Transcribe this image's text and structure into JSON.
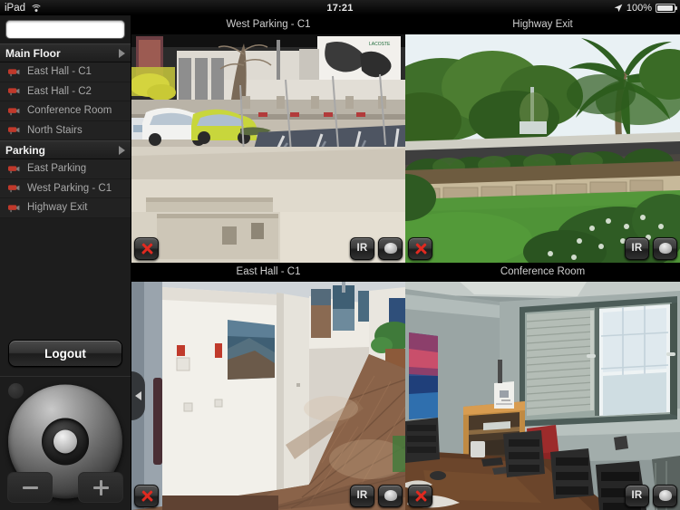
{
  "statusbar": {
    "device": "iPad",
    "wifi_icon": "wifi-icon",
    "time": "17:21",
    "location_icon": "location-arrow-icon",
    "battery_percent": "100%",
    "battery_icon": "battery-icon"
  },
  "sidebar": {
    "search": {
      "value": "",
      "placeholder": ""
    },
    "groups": [
      {
        "label": "Main Floor",
        "expanded": true,
        "cameras": [
          {
            "label": "East Hall - C1"
          },
          {
            "label": "East Hall - C2"
          },
          {
            "label": "Conference Room"
          },
          {
            "label": "North Stairs"
          }
        ]
      },
      {
        "label": "Parking",
        "expanded": true,
        "cameras": [
          {
            "label": "East Parking"
          },
          {
            "label": "West Parking - C1"
          },
          {
            "label": "Highway Exit"
          }
        ]
      }
    ],
    "logout_label": "Logout",
    "ptz": {
      "zoom_out_label": "−",
      "zoom_in_label": "+"
    }
  },
  "grid": {
    "cells": [
      {
        "title": "West Parking - C1",
        "selected": false,
        "scene": "outdoor-parking-lot",
        "controls": {
          "close_label": "close-icon",
          "ir_label": "IR",
          "record_label": "record-icon"
        }
      },
      {
        "title": "Highway Exit",
        "selected": true,
        "scene": "garden-palm-trees",
        "controls": {
          "close_label": "close-icon",
          "ir_label": "IR",
          "record_label": "record-icon"
        }
      },
      {
        "title": "East Hall - C1",
        "selected": false,
        "scene": "office-hallway",
        "controls": {
          "close_label": "close-icon",
          "ir_label": "IR",
          "record_label": "record-icon"
        }
      },
      {
        "title": "Conference Room",
        "selected": false,
        "scene": "conference-room",
        "controls": {
          "close_label": "close-icon",
          "ir_label": "IR",
          "record_label": "record-icon"
        }
      }
    ]
  },
  "colors": {
    "selection_border": "#9a8a22",
    "close_red": "#e02a20",
    "sidebar_bg": "#191919",
    "text_dim": "#a8a8a8"
  }
}
